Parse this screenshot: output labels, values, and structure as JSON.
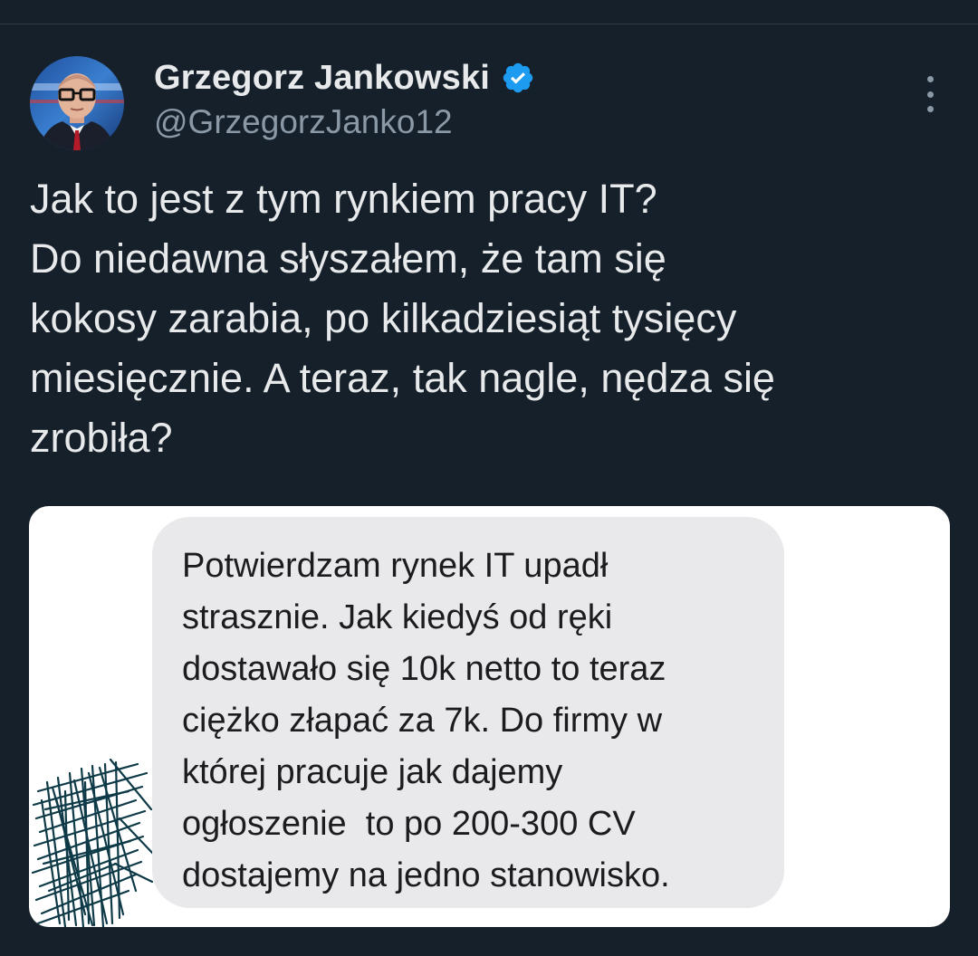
{
  "tweet": {
    "author": {
      "display_name": "Grzegorz Jankowski",
      "handle": "@GrzegorzJanko12",
      "verified": true,
      "verified_icon": "verified-badge-icon",
      "avatar_icon": "avatar"
    },
    "text": "Jak to jest z tym rynkiem pracy IT?\nDo niedawna słyszałem, że tam się\nkokosy zarabia, po kilkadziesiąt tysięcy\nmiesięcznie. A teraz, tak nagle, nędza się\nzrobiła?",
    "more_icon": "more-options-icon",
    "media": {
      "message_text": "Potwierdzam rynek IT upadł\nstrasznie. Jak kiedyś od ręki\ndostawało się 10k netto to teraz\nciężko złapać za 7k. Do firmy w\nktórej pracuje jak dajemy\nogłoszenie  to po 200-300 CV\ndostajemy na jedno stanowisko."
    }
  },
  "colors": {
    "background": "#15202b",
    "primary_text": "#e7e9ea",
    "secondary_text": "#8b98a5",
    "verified_blue": "#1d9bf0",
    "bubble_gray": "#e9e9eb",
    "scribble": "#0e3a48"
  }
}
